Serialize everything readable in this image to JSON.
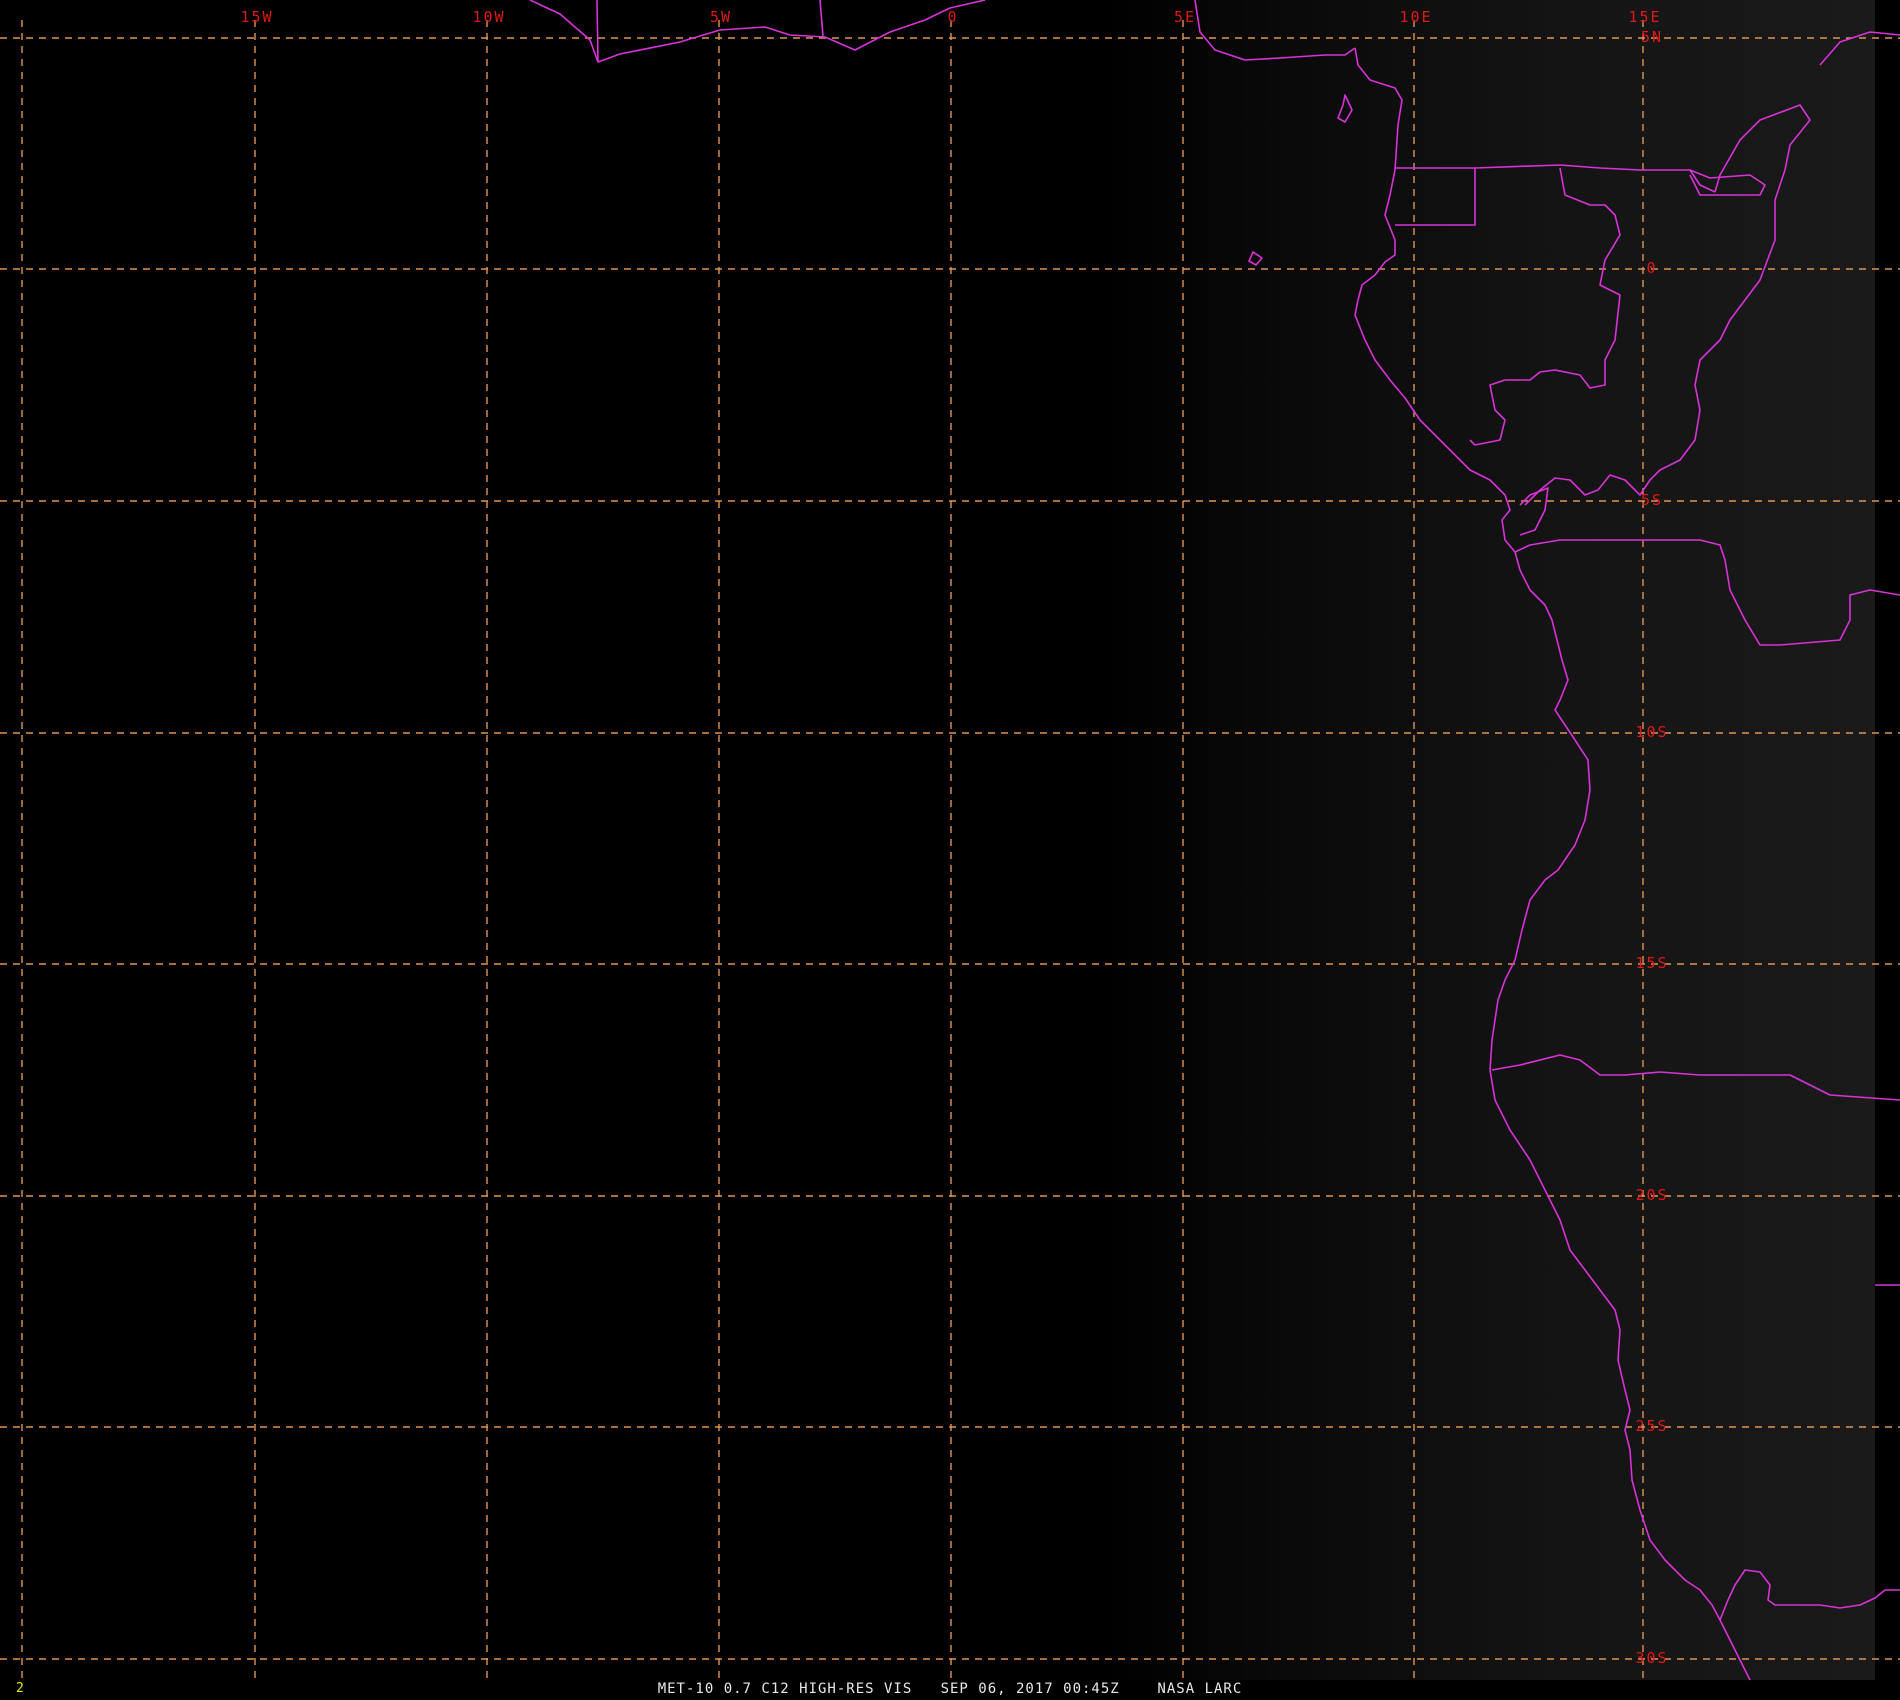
{
  "map": {
    "longitude_labels": [
      "15W",
      "10W",
      "5W",
      "0",
      "5E",
      "10E",
      "15E"
    ],
    "latitude_labels": [
      "5N",
      "0",
      "5S",
      "10S",
      "15S",
      "20S",
      "25S",
      "30S"
    ],
    "colors": {
      "background": "#000000",
      "graticule": "#e0954f",
      "borders": "#d832d8",
      "labels": "#e01818",
      "frame_number": "#e8e800",
      "caption": "#e8e8e8"
    }
  },
  "frame_number": "2",
  "caption": "MET-10 0.7 C12 HIGH-RES VIS   SEP 06, 2017 00:45Z    NASA LARC"
}
